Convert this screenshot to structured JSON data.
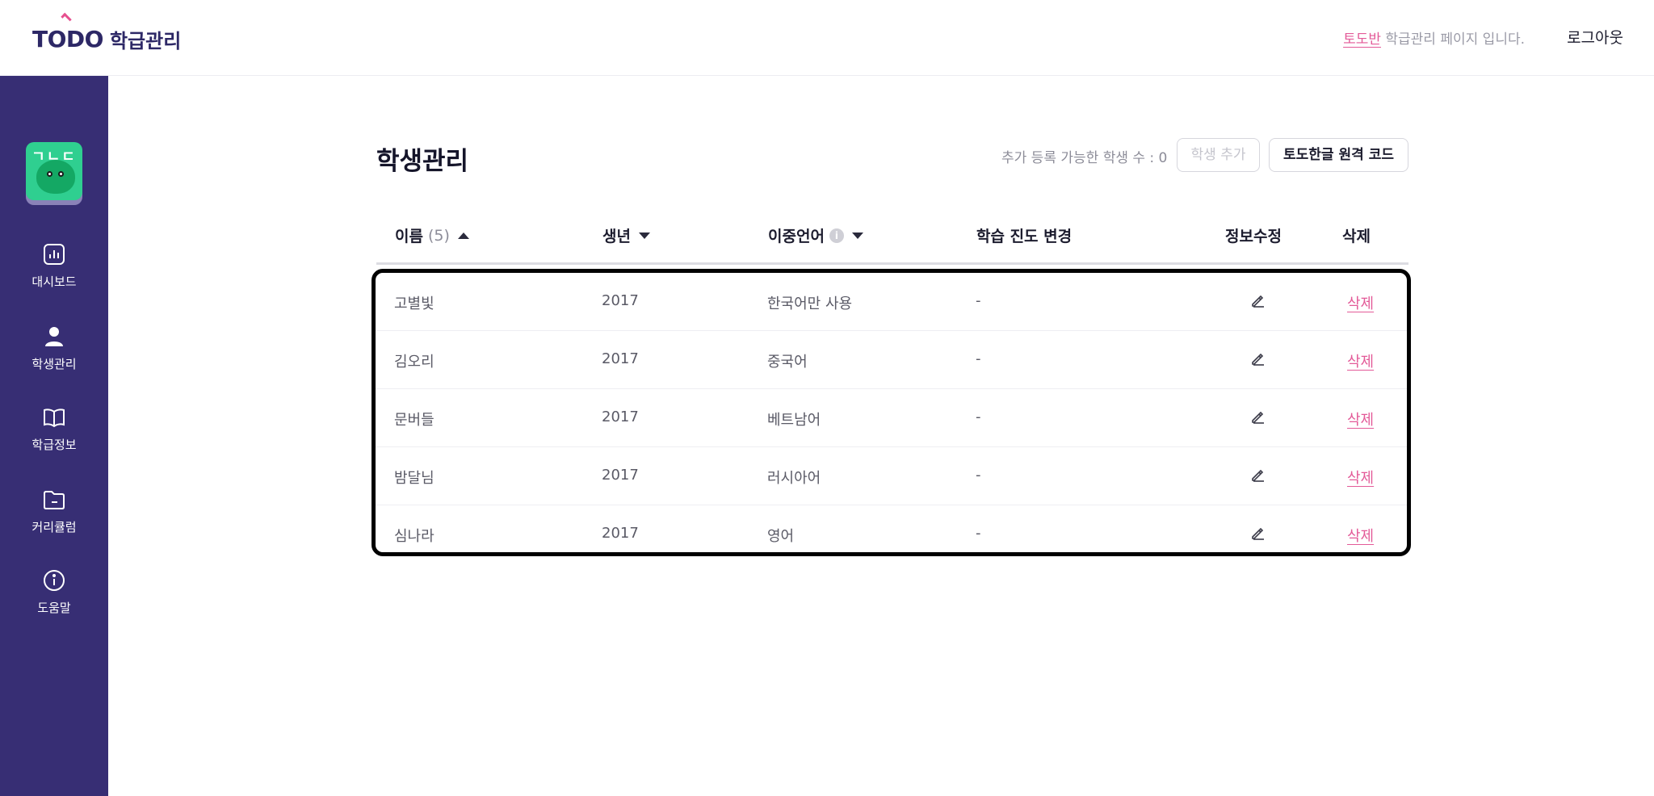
{
  "header": {
    "logo_todo": "TODO",
    "logo_sub": "학급관리",
    "class_name": "토도반",
    "message": " 학급관리 페이지 입니다.",
    "logout": "로그아웃"
  },
  "sidebar": {
    "avatar_text": "ㄱㄴㄷ",
    "items": [
      {
        "label": "대시보드",
        "icon": "dashboard-icon"
      },
      {
        "label": "학생관리",
        "icon": "person-icon"
      },
      {
        "label": "학급정보",
        "icon": "book-icon"
      },
      {
        "label": "커리큘럼",
        "icon": "folder-icon"
      },
      {
        "label": "도움말",
        "icon": "info-icon"
      }
    ]
  },
  "main": {
    "title": "학생관리",
    "available_text": "추가 등록 가능한 학생 수 : 0",
    "add_button": "학생 추가",
    "code_button": "토도한글 원격 코드",
    "columns": {
      "name": "이름",
      "count": "(5)",
      "year": "생년",
      "language": "이중언어",
      "progress": "학습 진도 변경",
      "edit": "정보수정",
      "delete": "삭제"
    },
    "rows": [
      {
        "name": "고별빛",
        "year": "2017",
        "language": "한국어만 사용",
        "progress": "-",
        "delete": "삭제"
      },
      {
        "name": "김오리",
        "year": "2017",
        "language": "중국어",
        "progress": "-",
        "delete": "삭제"
      },
      {
        "name": "문버들",
        "year": "2017",
        "language": "베트남어",
        "progress": "-",
        "delete": "삭제"
      },
      {
        "name": "밤달님",
        "year": "2017",
        "language": "러시아어",
        "progress": "-",
        "delete": "삭제"
      },
      {
        "name": "심나라",
        "year": "2017",
        "language": "영어",
        "progress": "-",
        "delete": "삭제"
      }
    ]
  },
  "colors": {
    "sidebar": "#372e74",
    "accent": "#e35a98",
    "brand": "#2d2866"
  }
}
